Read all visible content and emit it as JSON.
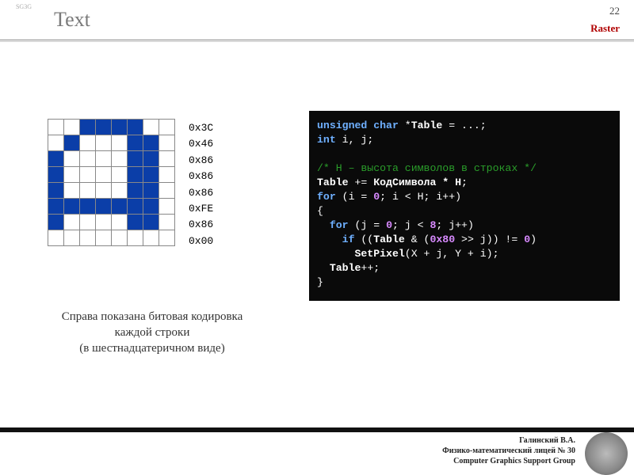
{
  "header": {
    "title": "Text",
    "page": "22",
    "tag": "Raster",
    "logo": "SG3G"
  },
  "bitmap": {
    "rows": [
      [
        0,
        0,
        1,
        1,
        1,
        1,
        0,
        0
      ],
      [
        0,
        1,
        0,
        0,
        0,
        1,
        1,
        0
      ],
      [
        1,
        0,
        0,
        0,
        0,
        1,
        1,
        0
      ],
      [
        1,
        0,
        0,
        0,
        0,
        1,
        1,
        0
      ],
      [
        1,
        0,
        0,
        0,
        0,
        1,
        1,
        0
      ],
      [
        1,
        1,
        1,
        1,
        1,
        1,
        1,
        0
      ],
      [
        1,
        0,
        0,
        0,
        0,
        1,
        1,
        0
      ],
      [
        0,
        0,
        0,
        0,
        0,
        0,
        0,
        0
      ]
    ],
    "hex": [
      "0x3C",
      "0x46",
      "0x86",
      "0x86",
      "0x86",
      "0xFE",
      "0x86",
      "0x00"
    ]
  },
  "caption": {
    "l1": "Справа показана битовая кодировка",
    "l2": "каждой строки",
    "l3": "(в шестнадцатеричном виде)"
  },
  "code": {
    "t01": "unsigned char",
    "t02": " *",
    "t03": "Table",
    "t04": " = ...;",
    "t05": "int",
    "t06": " i, j;",
    "t07": "/* H – высота символов в строках */",
    "t08": "Table",
    "t09": " += ",
    "t10": "КодСимвола * H",
    "t11": "for",
    "t12": " (i = ",
    "t13": "0",
    "t14": "; i < H; i++)",
    "t15": "{",
    "t16": "for",
    "t17": " (j = ",
    "t18": "0",
    "t19": "; j < ",
    "t20": "8",
    "t21": "; j++)",
    "t22": "if",
    "t23": " ((",
    "t24": "Table",
    "t25": " & (",
    "t26": "0x80",
    "t27": " >> j)) != ",
    "t28": "0",
    "t29": ")",
    "t30": "SetPixel",
    "t31": "(X + j, Y + i);",
    "t32": "Table",
    "t33": "++;",
    "t34": "}"
  },
  "footer": {
    "l1": "Галинский В.А.",
    "l2": "Физико-математический лицей № 30",
    "l3": "Computer Graphics Support Group"
  }
}
